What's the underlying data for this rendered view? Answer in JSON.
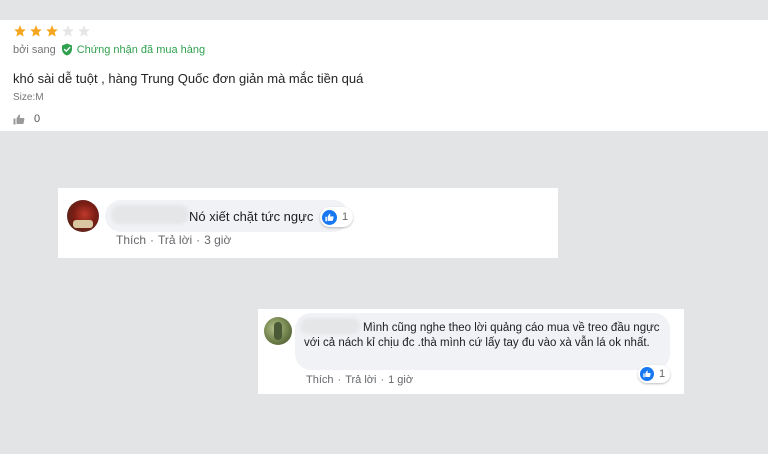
{
  "review": {
    "rating": 3,
    "max_rating": 5,
    "reviewer": "bởi sang",
    "verified_label": "Chứng nhận đã mua hàng",
    "text": "khó sài dễ tuột , hàng Trung Quốc đơn giản mà mắc tiền quá",
    "size": "Size:M",
    "like_count": "0"
  },
  "comments": [
    {
      "text": "Nó xiết chặt tức ngực",
      "reaction_count": "1",
      "like_label": "Thích",
      "reply_label": "Trả lời",
      "time": "3 giờ"
    },
    {
      "text": "Mình cũng nghe theo lời quảng cáo mua về treo đầu ngực với cả nách kỉ chịu đc .thà mình cứ lấy tay đu vào xà vẫn lá ok nhất.",
      "reaction_count": "1",
      "like_label": "Thích",
      "reply_label": "Trả lời",
      "time": "1 giờ"
    }
  ],
  "colors": {
    "star_filled": "#f5a623",
    "star_empty": "#e6e6e6",
    "verified_green": "#2fa14f",
    "like_blue": "#1877f2"
  }
}
